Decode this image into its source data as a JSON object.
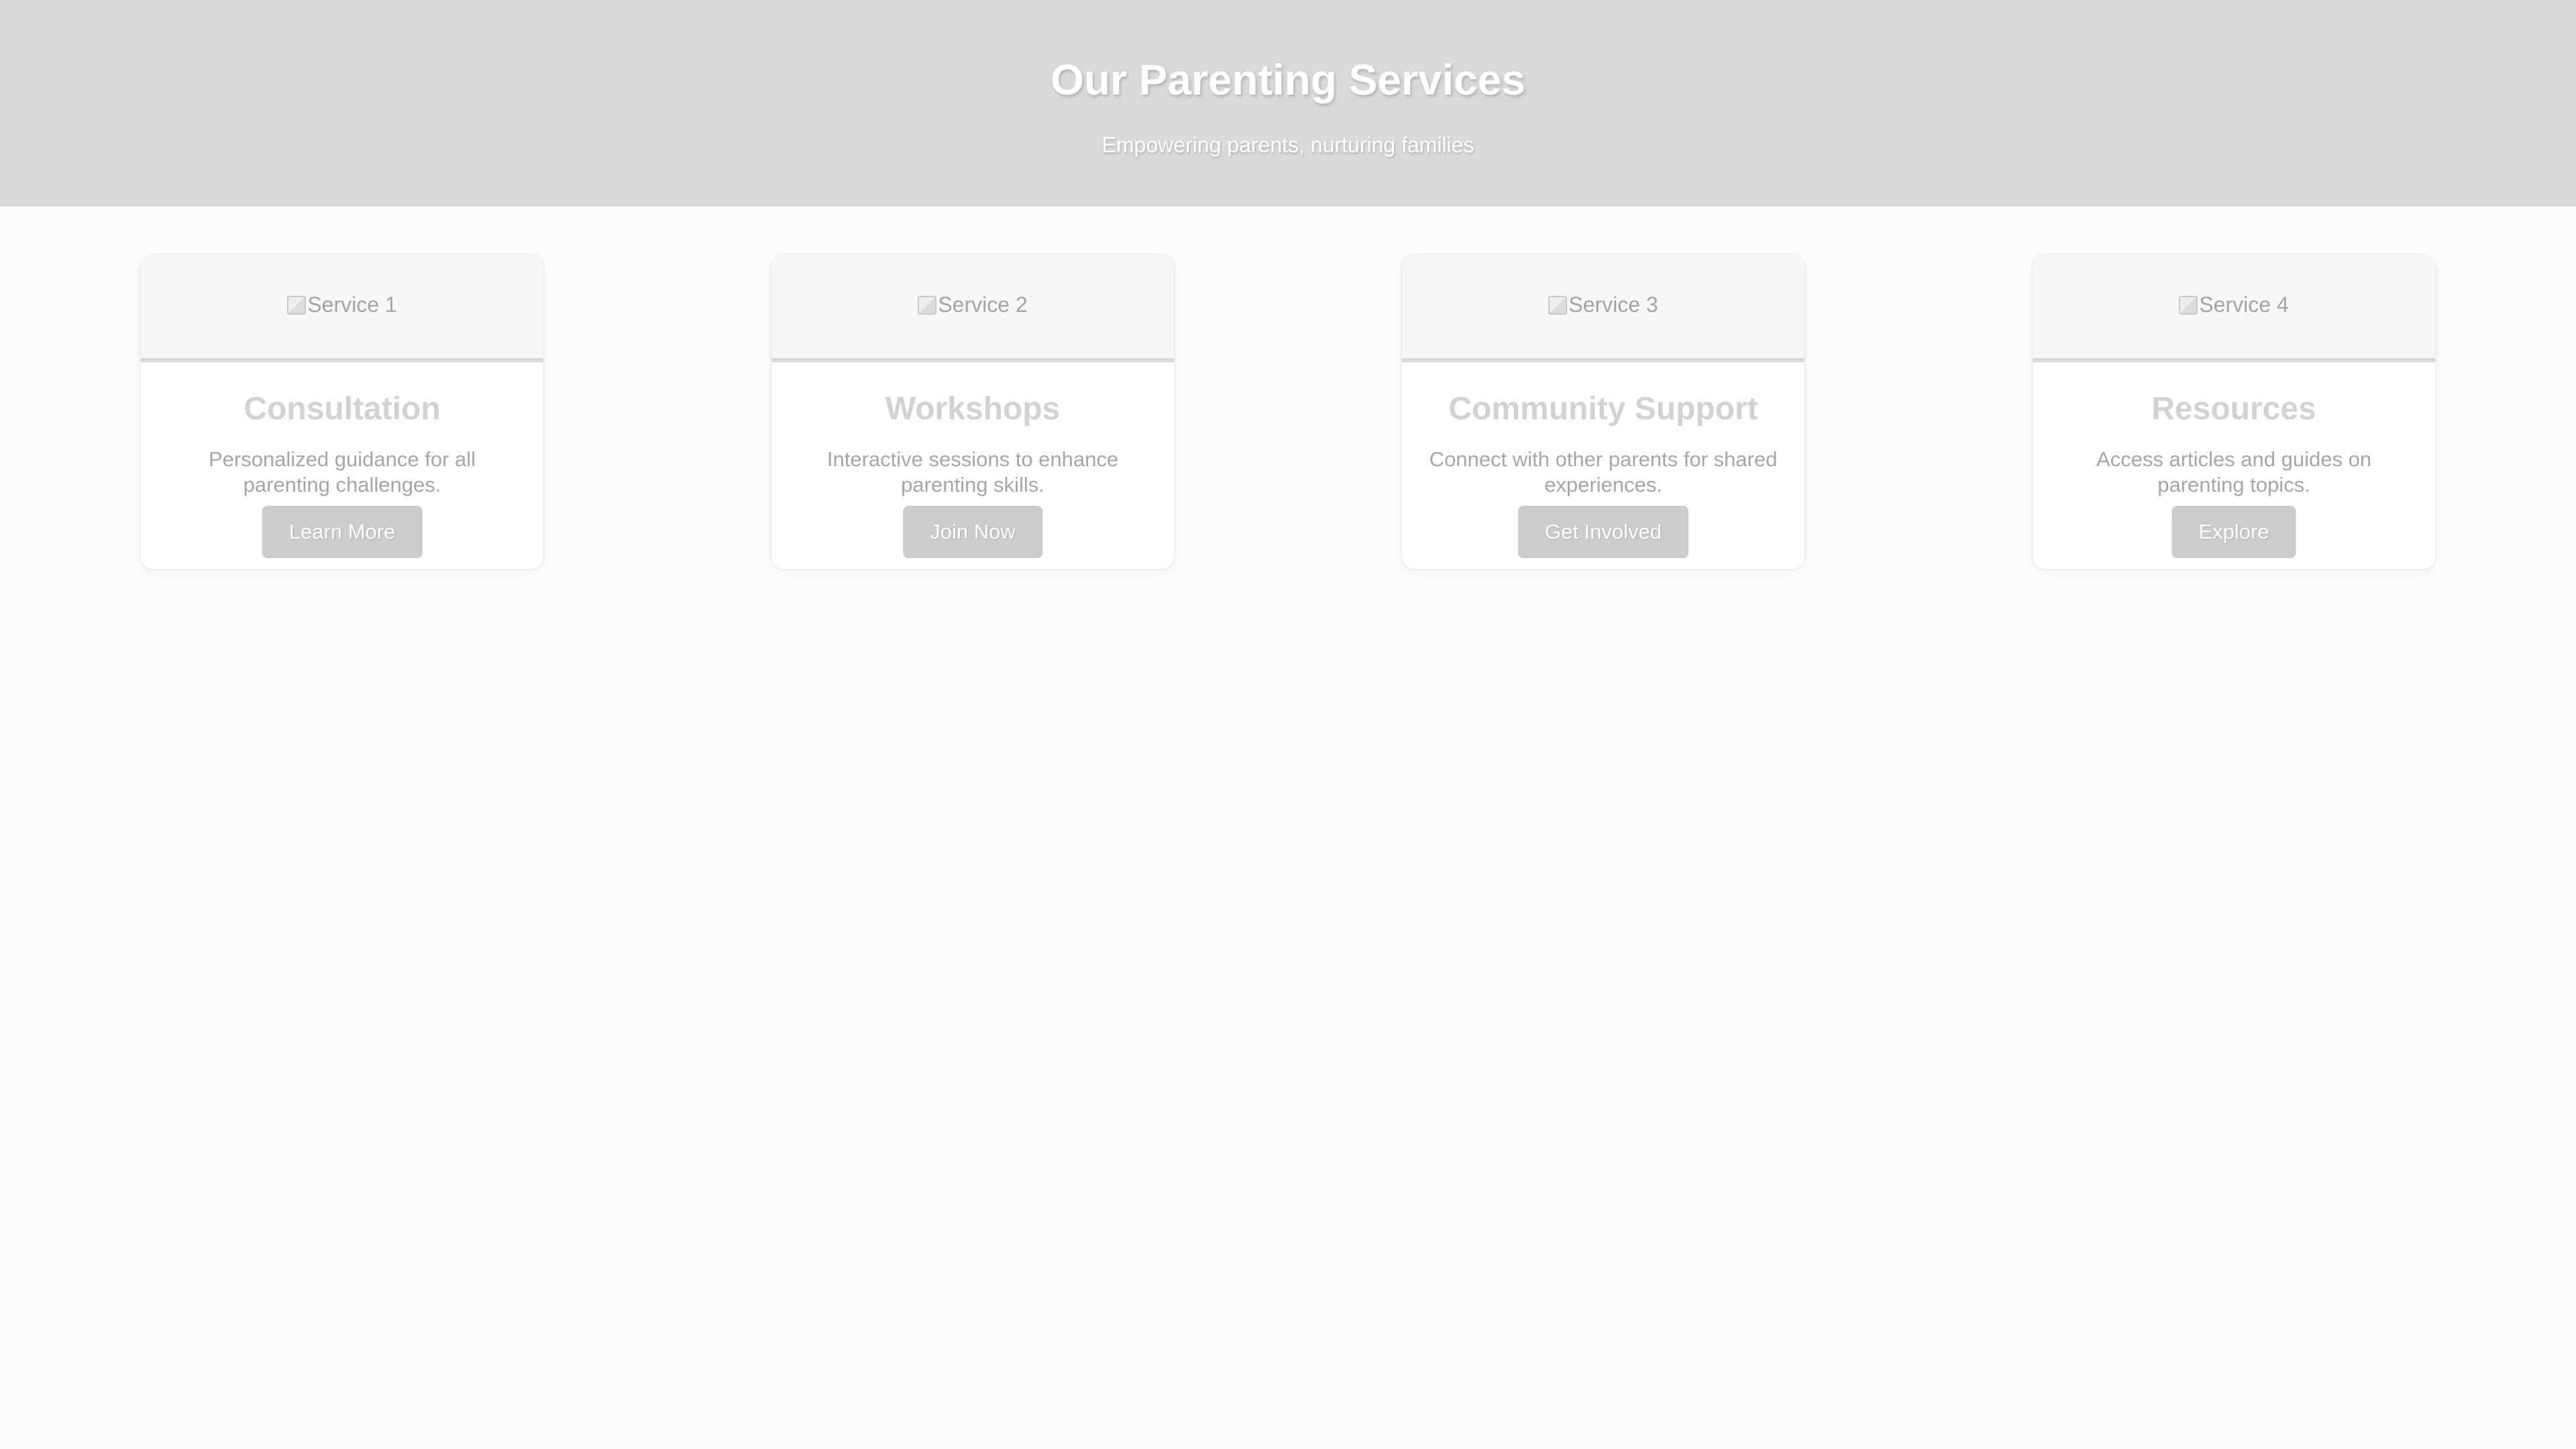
{
  "header": {
    "title": "Our Parenting Services",
    "subtitle": "Empowering parents, nurturing families"
  },
  "services": [
    {
      "image_alt": "Service 1",
      "title": "Consultation",
      "description": "Personalized guidance for all parenting challenges.",
      "button_label": "Learn More"
    },
    {
      "image_alt": "Service 2",
      "title": "Workshops",
      "description": "Interactive sessions to enhance parenting skills.",
      "button_label": "Join Now"
    },
    {
      "image_alt": "Service 3",
      "title": "Community Support",
      "description": "Connect with other parents for shared experiences.",
      "button_label": "Get Involved"
    },
    {
      "image_alt": "Service 4",
      "title": "Resources",
      "description": "Access articles and guides on parenting topics.",
      "button_label": "Explore"
    }
  ],
  "colors": {
    "header_background": "#d9d9d9",
    "page_background": "#fcfcfc",
    "button_background": "#cccccc"
  },
  "icons": {
    "card_image": "broken-image-icon"
  }
}
